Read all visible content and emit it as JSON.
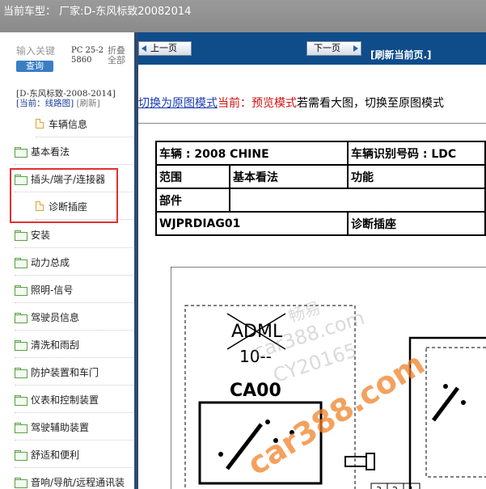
{
  "window": {
    "title": "当前车型：  厂家:D-东风标致20082014"
  },
  "sidebar": {
    "search_hint": "输入关键",
    "query_label": "查询",
    "pc_label": "PC 25-25860",
    "fold_label": "折叠全部",
    "tree_title": "[D-东风标致-2008-2014]",
    "tree_current": "[当前：线路图]",
    "tree_refresh": "[刷新]",
    "items": [
      {
        "label": "车辆信息",
        "type": "doc"
      },
      {
        "label": "基本看法",
        "type": "folder"
      },
      {
        "label": "插头/端子/连接器",
        "type": "folder"
      },
      {
        "label": "诊断插座",
        "type": "doc"
      },
      {
        "label": "安装",
        "type": "folder"
      },
      {
        "label": "动力总成",
        "type": "folder"
      },
      {
        "label": "照明-信号",
        "type": "folder"
      },
      {
        "label": "驾驶员信息",
        "type": "folder"
      },
      {
        "label": "清洗和雨刮",
        "type": "folder"
      },
      {
        "label": "防护装置和车门",
        "type": "folder"
      },
      {
        "label": "仪表和控制装置",
        "type": "folder"
      },
      {
        "label": "驾驶辅助装置",
        "type": "folder"
      },
      {
        "label": "舒适和便利",
        "type": "folder"
      },
      {
        "label": "音响/导航/远程通讯装",
        "type": "folder"
      }
    ]
  },
  "toolbar": {
    "prev_label": "上一页",
    "next_label": "下一页",
    "refresh_label": "[刷新当前页.]"
  },
  "mode": {
    "switch_link": "切换为原图模式",
    "current_label": "当前：预览模式",
    "hint": "若需看大图，切换至原图模式"
  },
  "info_table": {
    "vehicle": "车辆 : 2008 CHINE",
    "vin_label": "车辆识别号码 : LDC",
    "scope_label": "范围",
    "scope_value": "基本看法",
    "function_label": "功能",
    "part_label": "部件",
    "code": "WJPRDIAG01",
    "code_name": "诊断插座"
  },
  "diagram": {
    "crossed_label": "ADML",
    "sub_label": "10--",
    "connector": "CA00",
    "pins": [
      "3",
      "2",
      "1"
    ],
    "below_mark": "~"
  },
  "watermarks": [
    "畅易",
    "car388.com",
    "CY20165",
    "car388.com"
  ]
}
